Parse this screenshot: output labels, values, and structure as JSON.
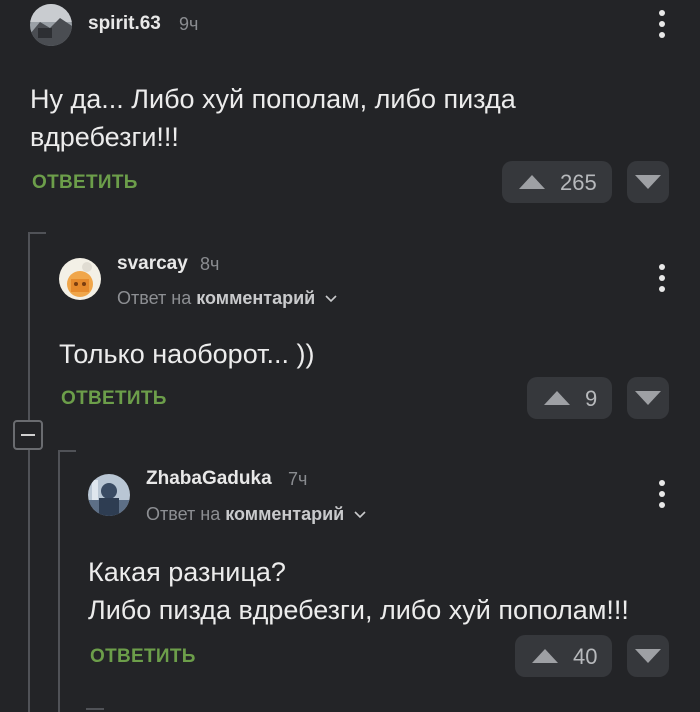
{
  "comments": [
    {
      "username": "spirit.63",
      "time": "9ч",
      "text_lines": [
        "Ну да... Либо хуй пополам, либо пизда",
        "вдребезги!!!"
      ],
      "reply_label": "ОТВЕТИТЬ",
      "rating": "265"
    },
    {
      "username": "svarcay",
      "time": "8ч",
      "reply_to_prefix": "Ответ на",
      "reply_to_link": "комментарий",
      "text_lines": [
        "Только наоборот... ))"
      ],
      "reply_label": "ОТВЕТИТЬ",
      "rating": "9"
    },
    {
      "username": "ZhabaGaduka",
      "time": "7ч",
      "reply_to_prefix": "Ответ на",
      "reply_to_link": "комментарий",
      "text_lines": [
        "Какая разница?",
        "Либо пизда вдребезги, либо хуй пополам!!!"
      ],
      "reply_label": "ОТВЕТИТЬ",
      "rating": "40"
    }
  ],
  "icons": {
    "upvote": "triangle-up-icon",
    "downvote": "triangle-down-icon",
    "more": "kebab-menu-icon",
    "chevron": "chevron-down-icon",
    "collapse": "collapse-thread-icon"
  },
  "colors": {
    "background": "#232427",
    "reply_link": "#6c9e4a",
    "vote_bg": "#36383c"
  }
}
